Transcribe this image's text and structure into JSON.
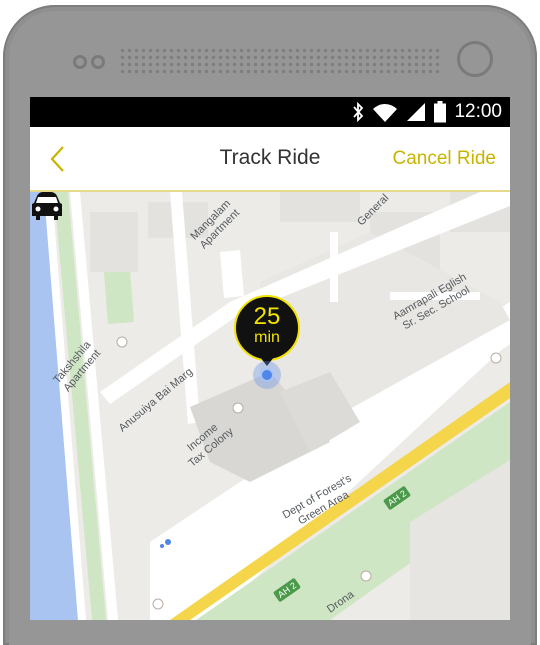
{
  "status_bar": {
    "time": "12:00",
    "icons": [
      "bluetooth-icon",
      "wifi-icon",
      "signal-icon",
      "battery-icon"
    ]
  },
  "app_bar": {
    "title": "Track Ride",
    "cancel_label": "Cancel Ride",
    "back_icon": "chevron-left-icon"
  },
  "eta": {
    "value": "25",
    "unit": "min"
  },
  "map_labels": {
    "mangalam": "Mangalam\nApartment",
    "general": "General",
    "aamrapali": "Aamrapali Eglish\nSr. Sec. School",
    "takshshila": "Takshshila\nApartment",
    "anusuiya": "Anusuiya Bai Marg",
    "income_tax": "Income\nTax Colony",
    "forest": "Dept of Forest's\nGreen Area",
    "drona": "Drona"
  },
  "highway_badges": {
    "top": "AH 2",
    "bottom": "AH 2"
  },
  "colors": {
    "accent": "#c8b400",
    "eta_yellow": "#f3e300",
    "map_bg": "#ecebe8",
    "road": "#ffffff",
    "highway": "#f5d54a",
    "water": "#a9c4f0",
    "green_area": "#cfe6c4"
  }
}
